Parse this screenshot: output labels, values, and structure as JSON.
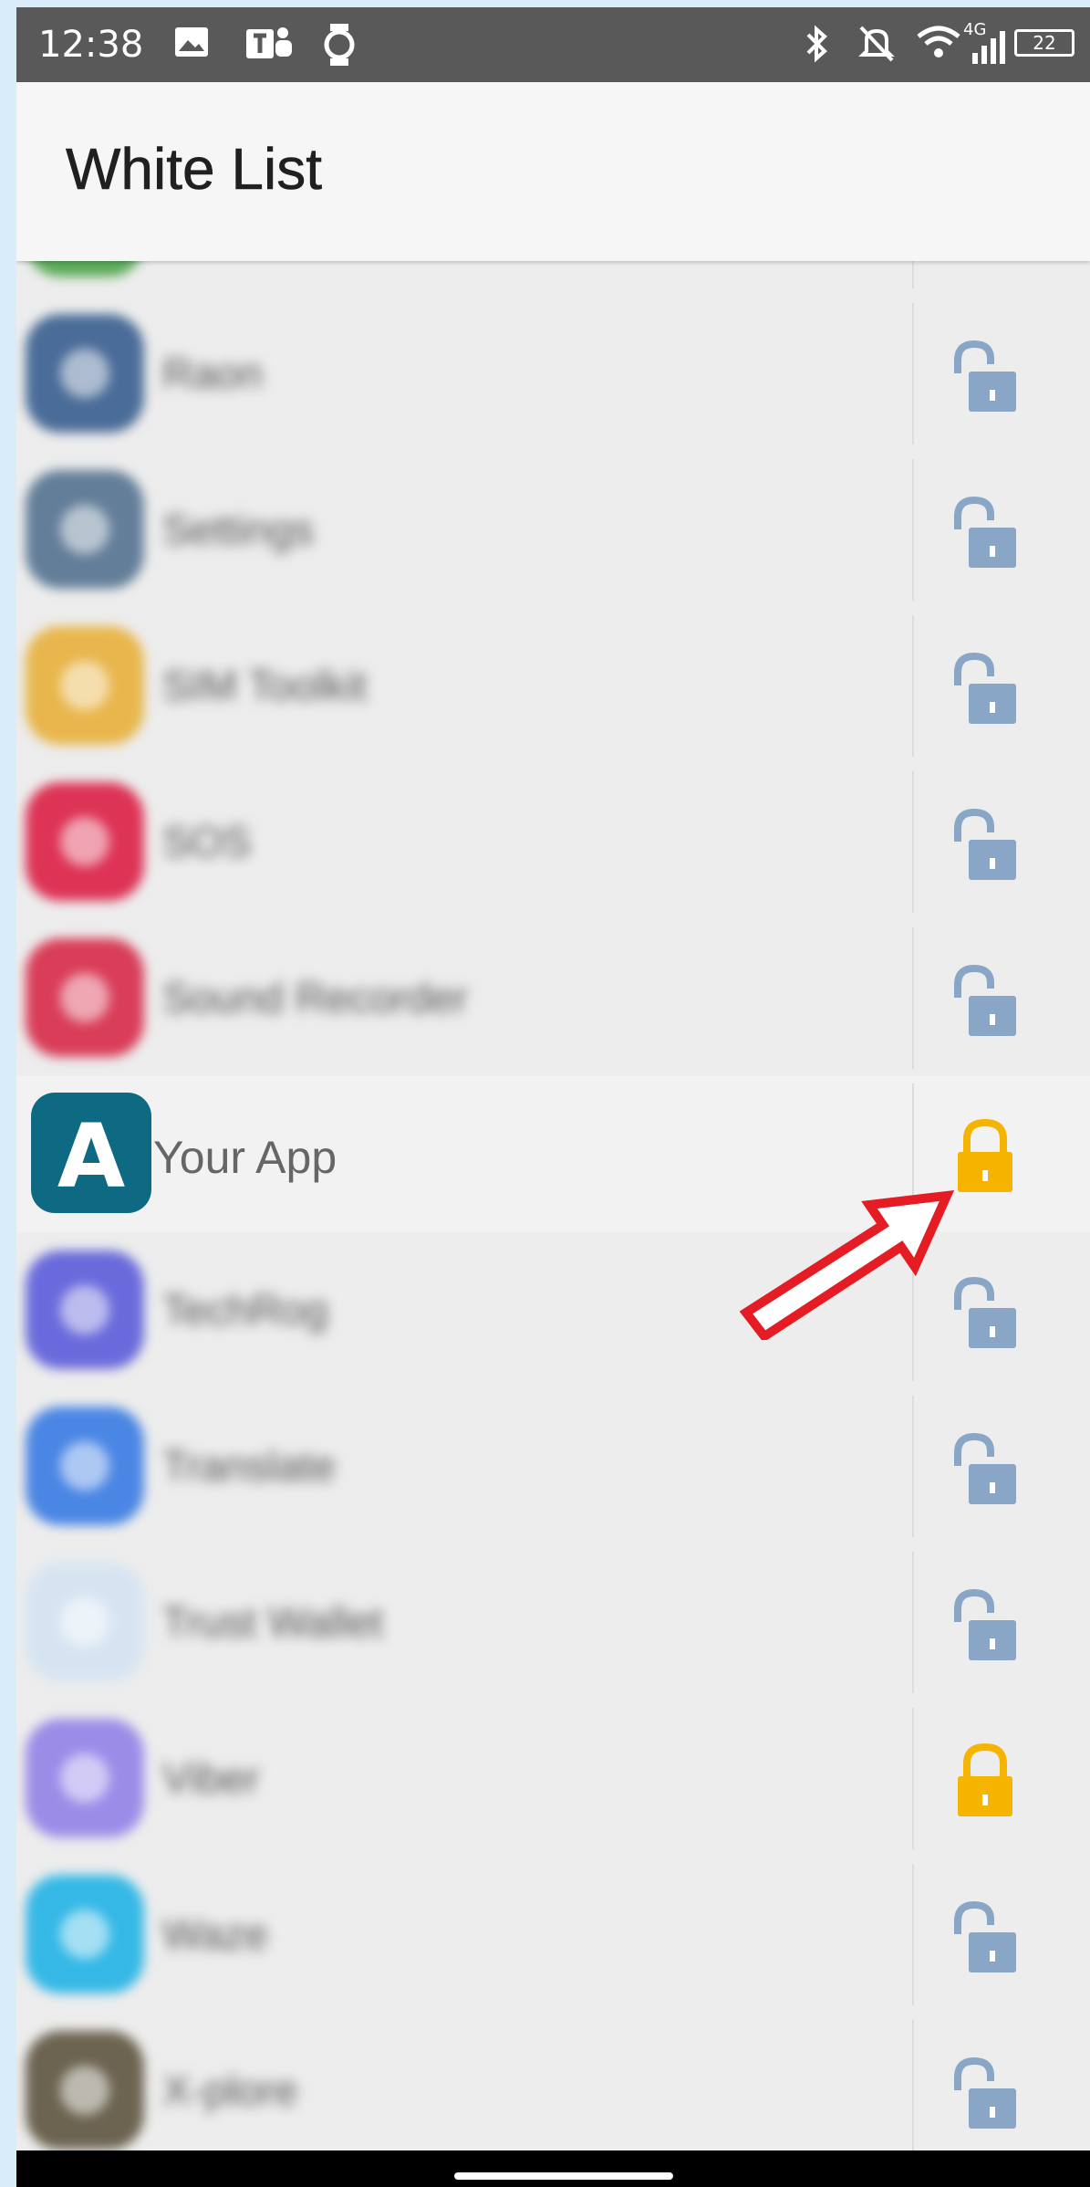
{
  "status_bar": {
    "time": "12:38",
    "network": "4G",
    "battery": "22",
    "icons": [
      "image-icon",
      "teams-icon",
      "watch-icon",
      "bluetooth-icon",
      "mute-icon",
      "wifi-icon",
      "signal-icon",
      "battery-icon"
    ]
  },
  "app_bar": {
    "title": "White List"
  },
  "colors": {
    "locked": "#f5b400",
    "unlocked": "#8aa6c6",
    "app_icon": "#0e6a82",
    "annotation_arrow": "#e51c23"
  },
  "apps": [
    {
      "name": "",
      "icon_color": "#5aa858",
      "locked": false
    },
    {
      "name": "Raon",
      "icon_color": "#4a6c98",
      "locked": false
    },
    {
      "name": "Settings",
      "icon_color": "#637e99",
      "locked": false
    },
    {
      "name": "SIM Toolkit",
      "icon_color": "#e8b64c",
      "locked": false
    },
    {
      "name": "SOS",
      "icon_color": "#dd3355",
      "locked": false
    },
    {
      "name": "Sound Recorder",
      "icon_color": "#d93d58",
      "locked": false
    },
    {
      "name": "Your App",
      "icon_letter": "A",
      "icon_color": "#0e6a82",
      "locked": true
    },
    {
      "name": "TechRog",
      "icon_color": "#6a6adc",
      "locked": false
    },
    {
      "name": "Translate",
      "icon_color": "#4a86e4",
      "locked": false
    },
    {
      "name": "Trust Wallet",
      "icon_color": "#d6e4f2",
      "locked": false
    },
    {
      "name": "Viber",
      "icon_color": "#9b8ce8",
      "locked": true
    },
    {
      "name": "Waze",
      "icon_color": "#35b8e6",
      "locked": false
    },
    {
      "name": "X-plore",
      "icon_color": "#6c6450",
      "locked": false
    }
  ]
}
